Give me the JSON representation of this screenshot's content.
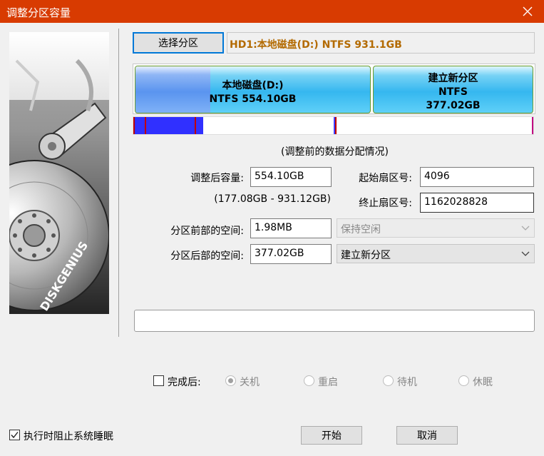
{
  "window": {
    "title": "调整分区容量"
  },
  "left_panel": {
    "brand": "DISKGENIUS"
  },
  "select_partition_label": "选择分区",
  "disk_info": "HD1:本地磁盘(D:) NTFS 931.1GB",
  "partitions": [
    {
      "name": "本地磁盘(D:)",
      "fs_size": "NTFS 554.10GB",
      "used_fraction": 0.32
    },
    {
      "name": "建立新分区",
      "fs": "NTFS",
      "size": "377.02GB"
    }
  ],
  "note": "(调整前的数据分配情况)",
  "fields": {
    "resized_capacity_label": "调整后容量:",
    "resized_capacity_value": "554.10GB",
    "range_hint": "(177.08GB - 931.12GB)",
    "start_sector_label": "起始扇区号:",
    "start_sector_value": "4096",
    "end_sector_label": "终止扇区号:",
    "end_sector_value": "1162028828",
    "space_before_label": "分区前部的空间:",
    "space_before_value": "1.98MB",
    "space_before_option": "保持空闲",
    "space_after_label": "分区后部的空间:",
    "space_after_value": "377.02GB",
    "space_after_option": "建立新分区"
  },
  "progress": {
    "value": 0.0
  },
  "after_complete": {
    "label": "完成后:",
    "options": [
      "关机",
      "重启",
      "待机",
      "休眠"
    ],
    "selected_index": 0
  },
  "prevent_sleep_label": "执行时阻止系统睡眠",
  "start_button": "开始",
  "cancel_button": "取消",
  "colors": {
    "titlebar": "#d83b01",
    "disk_info_text": "#b36a00",
    "focus_border": "#0078d7"
  }
}
